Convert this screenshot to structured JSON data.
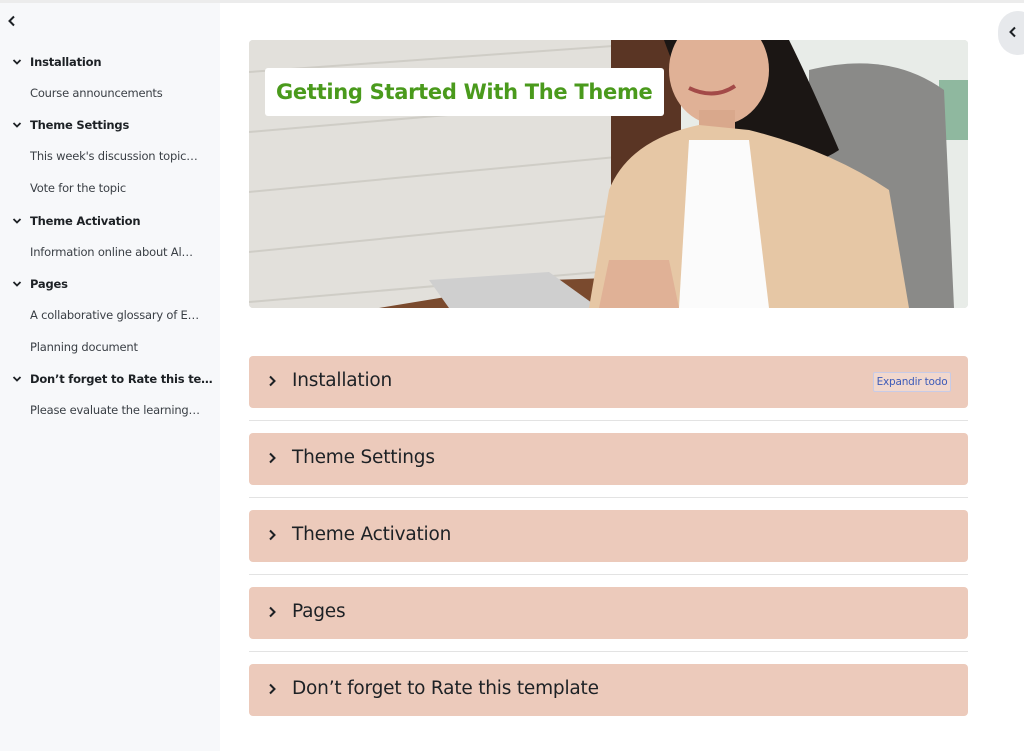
{
  "sidebar": {
    "close_icon": "chevron-left-icon",
    "sections": [
      {
        "label": "Installation",
        "activities": [
          "Course announcements"
        ]
      },
      {
        "label": "Theme Settings",
        "activities": [
          "This week's discussion topic…",
          "Vote for the topic"
        ]
      },
      {
        "label": "Theme Activation",
        "activities": [
          "Information online about Al…"
        ]
      },
      {
        "label": "Pages",
        "activities": [
          "A collaborative glossary of E…",
          "Planning document"
        ]
      },
      {
        "label": "Don’t forget to Rate this te…",
        "activities": [
          "Please evaluate the learning…"
        ]
      }
    ]
  },
  "hero": {
    "title": "Getting Started With The Theme"
  },
  "main": {
    "expand_all_label": "Expandir todo",
    "sections": [
      {
        "title": "Installation"
      },
      {
        "title": "Theme Settings"
      },
      {
        "title": "Theme Activation"
      },
      {
        "title": "Pages"
      },
      {
        "title": "Don’t forget to Rate this template"
      }
    ]
  },
  "drawer": {
    "toggle_icon": "chevron-left-icon"
  },
  "colors": {
    "title_green": "#4a9a1c",
    "section_bar": "#eccabb",
    "sidebar_bg": "#f7f8fa",
    "link_blue": "#3d5bb8"
  }
}
